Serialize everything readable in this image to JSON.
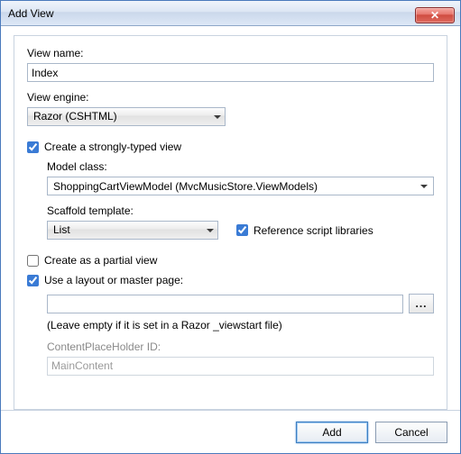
{
  "window": {
    "title": "Add View"
  },
  "viewName": {
    "label": "View name:",
    "value": "Index"
  },
  "viewEngine": {
    "label": "View engine:",
    "value": "Razor (CSHTML)"
  },
  "stronglyTyped": {
    "label": "Create a strongly-typed view",
    "checked": true,
    "modelClass": {
      "label": "Model class:",
      "value": "ShoppingCartViewModel (MvcMusicStore.ViewModels)"
    },
    "scaffold": {
      "label": "Scaffold template:",
      "value": "List"
    },
    "refScripts": {
      "label": "Reference script libraries",
      "checked": true
    }
  },
  "partial": {
    "label": "Create as a partial view",
    "checked": false
  },
  "layout": {
    "label": "Use a layout or master page:",
    "checked": true,
    "path": "",
    "browse": "...",
    "hint": "(Leave empty if it is set in a Razor _viewstart file)",
    "cph": {
      "label": "ContentPlaceHolder ID:",
      "value": "MainContent"
    }
  },
  "buttons": {
    "add": "Add",
    "cancel": "Cancel"
  },
  "closeGlyph": "✕"
}
